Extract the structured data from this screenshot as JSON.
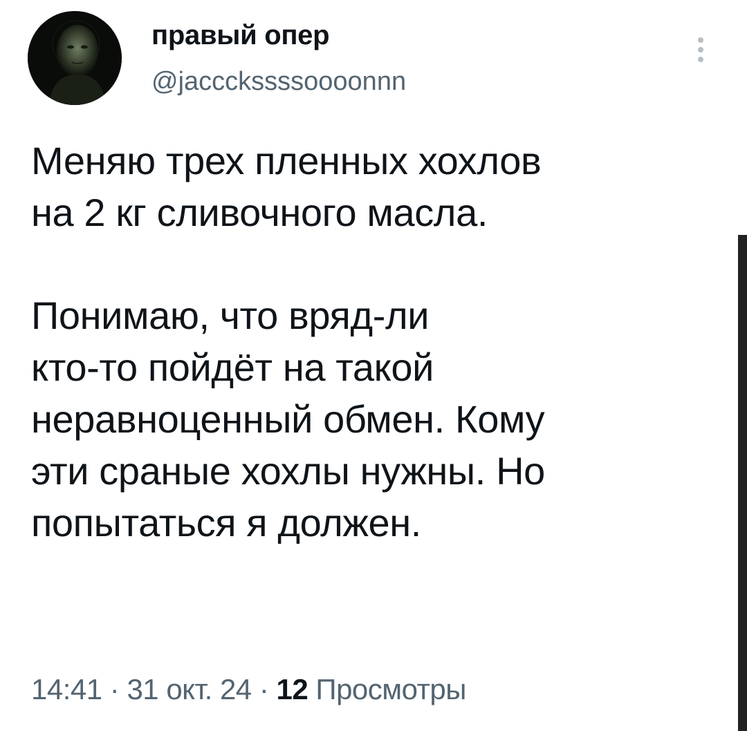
{
  "author": {
    "display_name": "правый опер",
    "handle": "@jaccckssssoooonnn"
  },
  "tweet": {
    "lines": [
      "Меняю трех пленных хохлов",
      "на 2 кг сливочного масла.",
      "Понимаю, что вряд-ли",
      "кто-то пойдёт на такой",
      "неравноценный обмен. Кому",
      "эти сраные хохлы нужны. Но",
      "попытаться я должен."
    ]
  },
  "meta": {
    "time": "14:41",
    "separator": " · ",
    "date": "31 окт. 24",
    "views_count": "12",
    "views_label": " Просмотры"
  },
  "icons": {
    "more": "more-vertical-icon"
  },
  "colors": {
    "text": "#0f1419",
    "secondary": "#536471",
    "background": "#ffffff",
    "scrollbar": "#222222"
  }
}
